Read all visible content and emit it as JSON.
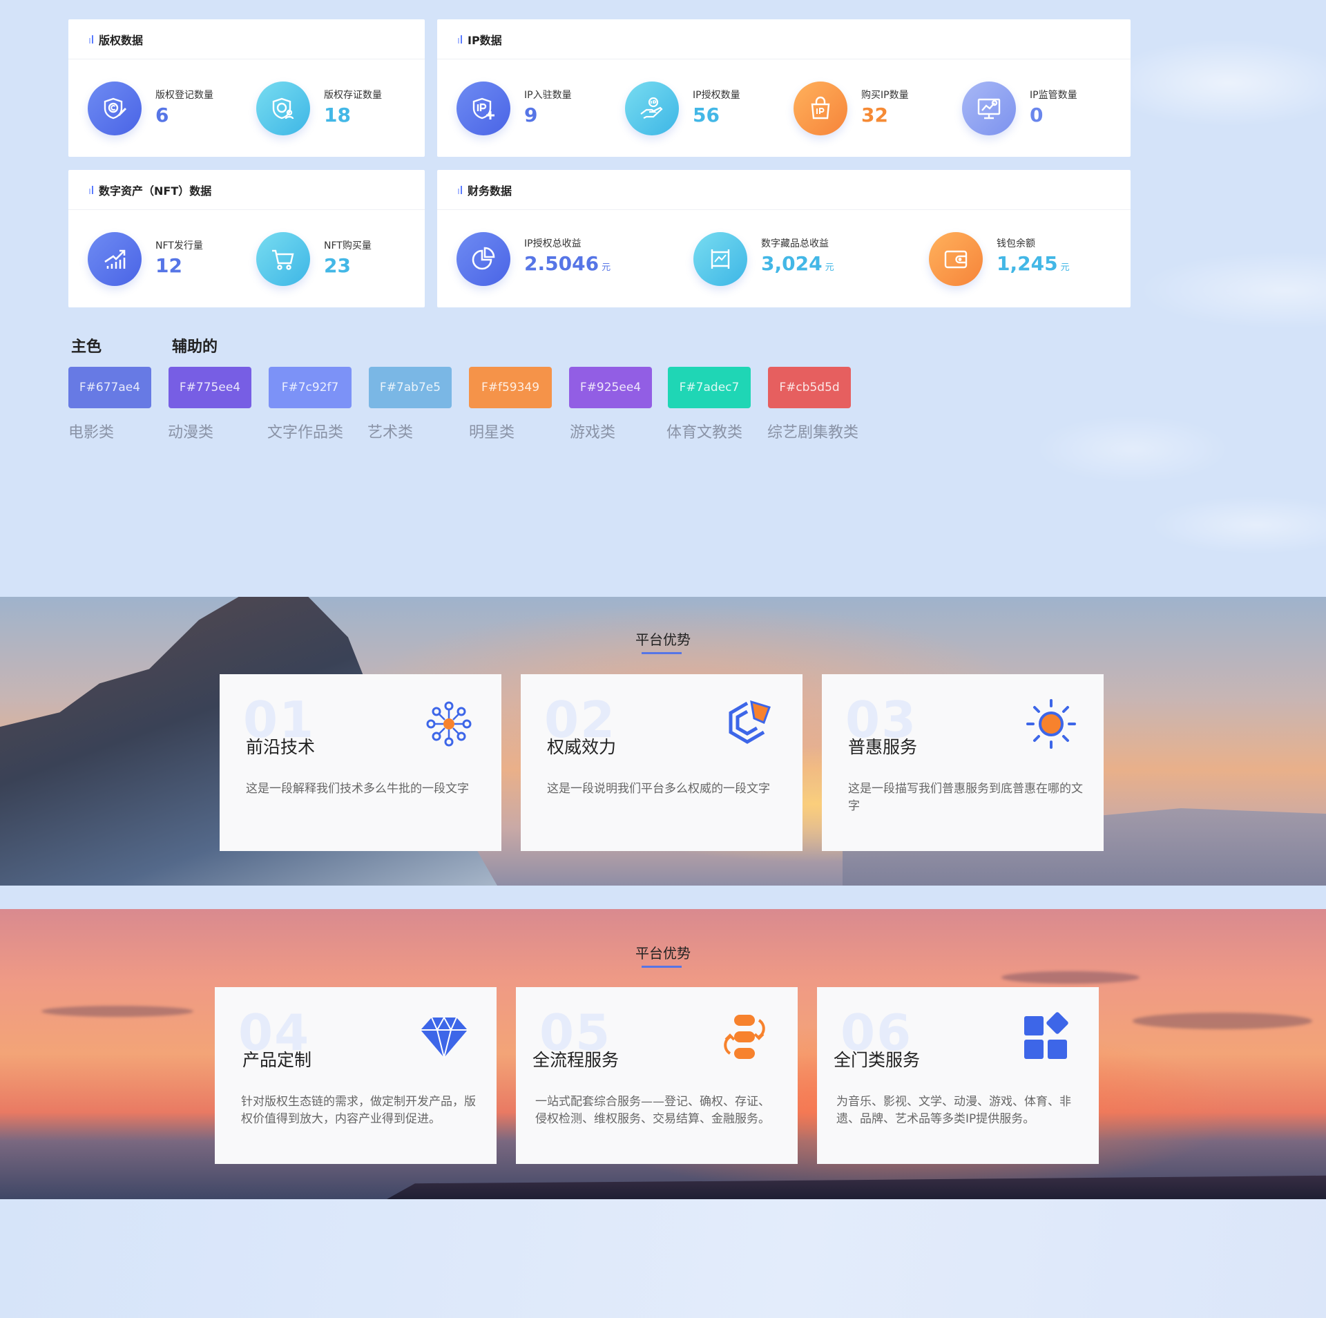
{
  "copyright": {
    "title": "版权数据",
    "stats": [
      {
        "label": "版权登记数量",
        "value": "6"
      },
      {
        "label": "版权存证数量",
        "value": "18"
      }
    ]
  },
  "ip": {
    "title": "IP数据",
    "stats": [
      {
        "label": "IP入驻数量",
        "value": "9"
      },
      {
        "label": "IP授权数量",
        "value": "56"
      },
      {
        "label": "购买IP数量",
        "value": "32"
      },
      {
        "label": "IP监管数量",
        "value": "0"
      }
    ]
  },
  "nft": {
    "title": "数字资产（NFT）数据",
    "stats": [
      {
        "label": "NFT发行量",
        "value": "12"
      },
      {
        "label": "NFT购买量",
        "value": "23"
      }
    ]
  },
  "finance": {
    "title": "财务数据",
    "stats": [
      {
        "label": "IP授权总收益",
        "value": "2.5046",
        "unit": "元"
      },
      {
        "label": "数字藏品总收益",
        "value": "3,024",
        "unit": "元"
      },
      {
        "label": "钱包余额",
        "value": "1,245",
        "unit": "元"
      }
    ]
  },
  "palette": {
    "primary_label": "主色",
    "secondary_label": "辅助的",
    "swatches": [
      {
        "code": "F#677ae4",
        "color": "#677ae4",
        "name": "电影类"
      },
      {
        "code": "F#775ee4",
        "color": "#775ee4",
        "name": "动漫类"
      },
      {
        "code": "F#7c92f7",
        "color": "#7c92f7",
        "name": "文字作品类"
      },
      {
        "code": "F#7ab7e5",
        "color": "#7ab7e5",
        "name": "艺术类"
      },
      {
        "code": "F#f59349",
        "color": "#f59349",
        "name": "明星类"
      },
      {
        "code": "F#925ee4",
        "color": "#925ee4",
        "name": "游戏类"
      },
      {
        "code": "F#7adec7",
        "color": "#1fd6b5",
        "name": "体育文教类"
      },
      {
        "code": "F#cb5d5d",
        "color": "#e65f5f",
        "name": "综艺剧集教类"
      }
    ]
  },
  "advantages_1": {
    "title": "平台优势",
    "cards": [
      {
        "num": "01",
        "title": "前沿技术",
        "desc": "这是一段解释我们技术多么牛批的一段文字",
        "icon": "network-icon"
      },
      {
        "num": "02",
        "title": "权威效力",
        "desc": "这是一段说明我们平台多么权威的一段文字",
        "icon": "authority-badge-icon"
      },
      {
        "num": "03",
        "title": "普惠服务",
        "desc": "这是一段描写我们普惠服务到底普惠在哪的文字",
        "icon": "sun-icon"
      }
    ]
  },
  "advantages_2": {
    "title": "平台优势",
    "cards": [
      {
        "num": "04",
        "title": "产品定制",
        "desc": "针对版权生态链的需求，做定制开发产品，版权价值得到放大，内容产业得到促进。",
        "icon": "diamond-icon"
      },
      {
        "num": "05",
        "title": "全流程服务",
        "desc": "一站式配套综合服务——登记、确权、存证、侵权检测、维权服务、交易结算、金融服务。",
        "icon": "cycle-icon"
      },
      {
        "num": "06",
        "title": "全门类服务",
        "desc": "为音乐、影视、文学、动漫、游戏、体育、非遗、品牌、艺术品等多类IP提供服务。",
        "icon": "category-grid-icon"
      }
    ]
  }
}
